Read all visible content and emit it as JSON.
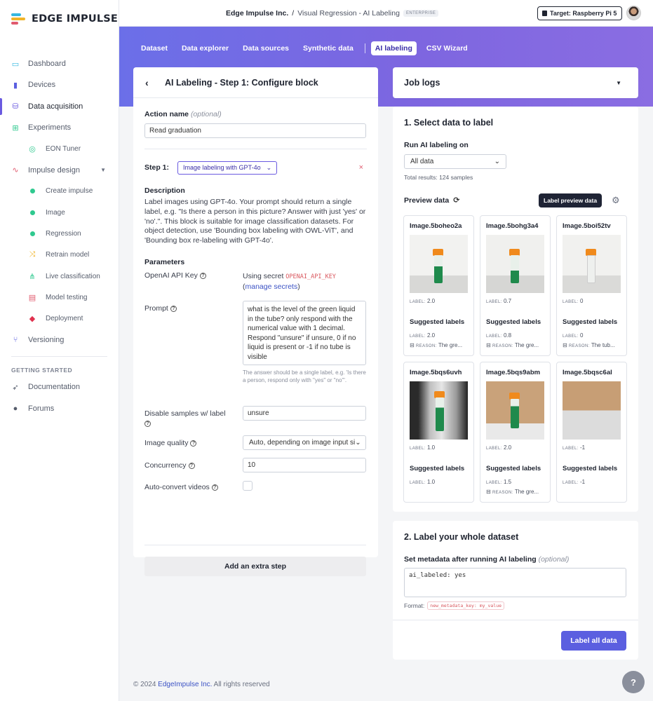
{
  "brand": {
    "name": "EDGE IMPULSE"
  },
  "sidebar": {
    "items": [
      {
        "label": "Dashboard",
        "icon": "monitor-icon",
        "color": "#36b7e0"
      },
      {
        "label": "Devices",
        "icon": "chip-icon",
        "color": "#5b5fe0"
      },
      {
        "label": "Data acquisition",
        "icon": "database-icon",
        "color": "#6a5ae0"
      },
      {
        "label": "Experiments",
        "icon": "table-icon",
        "color": "#2fc98f"
      },
      {
        "label": "EON Tuner",
        "icon": "compass-icon",
        "color": "#2fc98f"
      },
      {
        "label": "Impulse design",
        "icon": "pulse-icon",
        "color": "#e05a6e"
      },
      {
        "label": "Create impulse",
        "icon": "dot-icon"
      },
      {
        "label": "Image",
        "icon": "dot-icon"
      },
      {
        "label": "Regression",
        "icon": "dot-icon"
      },
      {
        "label": "Retrain model",
        "icon": "shuffle-icon",
        "color": "#f0b429"
      },
      {
        "label": "Live classification",
        "icon": "network-icon",
        "color": "#2fc98f"
      },
      {
        "label": "Model testing",
        "icon": "clipboard-icon",
        "color": "#e05a6e"
      },
      {
        "label": "Deployment",
        "icon": "cube-icon",
        "color": "#e0314e"
      },
      {
        "label": "Versioning",
        "icon": "branch-icon",
        "color": "#5b5fe0"
      }
    ],
    "getting_started": "GETTING STARTED",
    "bottom_items": [
      {
        "label": "Documentation",
        "icon": "rocket-icon"
      },
      {
        "label": "Forums",
        "icon": "chat-icon"
      }
    ]
  },
  "header": {
    "org": "Edge Impulse Inc.",
    "separator": "/",
    "project": "Visual Regression - AI Labeling",
    "badge": "ENTERPRISE",
    "target": "Target: Raspberry Pi 5"
  },
  "tabs": [
    "Dataset",
    "Data explorer",
    "Data sources",
    "Synthetic data",
    "AI labeling",
    "CSV Wizard"
  ],
  "configure": {
    "title": "AI Labeling - Step 1: Configure block",
    "action_name_label": "Action name",
    "action_name_optional": "(optional)",
    "action_name_value": "Read graduation",
    "step_label": "Step 1:",
    "step_block": "Image labeling with GPT-4o",
    "description_heading": "Description",
    "description": "Label images using GPT-4o. Your prompt should return a single label, e.g. \"Is there a person in this picture? Answer with just 'yes' or 'no'.\". This block is suitable for image classification datasets. For object detection, use 'Bounding box labeling with OWL-ViT', and 'Bounding box re-labeling with GPT-4o'.",
    "parameters_heading": "Parameters",
    "api_key_label": "OpenAI API Key",
    "api_key_prefix": "Using secret ",
    "api_key_secret": "OPENAI_API_KEY",
    "api_key_link": "manage secrets",
    "prompt_label": "Prompt",
    "prompt_value": "what is the level of the green liquid in the tube? only respond with the numerical value with 1 decimal. Respond \"unsure\" if unsure, 0 if no liquid is present or -1 if no tube is visible",
    "prompt_help": "The answer should be a single label, e.g. 'Is there a person, respond only with \"yes\" or \"no\"'.",
    "disable_label": "Disable samples w/ label",
    "disable_value": "unsure",
    "quality_label": "Image quality",
    "quality_value": "Auto, depending on image input si",
    "concurrency_label": "Concurrency",
    "concurrency_value": "10",
    "autoconvert_label": "Auto-convert videos",
    "add_step": "Add an extra step"
  },
  "job_logs": {
    "title": "Job logs"
  },
  "select_data": {
    "title": "1. Select data to label",
    "run_on_label": "Run AI labeling on",
    "run_on_value": "All data",
    "total": "Total results: 124 samples",
    "preview_label": "Preview data",
    "preview_button": "Label preview data",
    "label_key": "LABEL:",
    "reason_key": "REASON:",
    "suggested": "Suggested labels",
    "samples": [
      {
        "name": "Image.5boheo2a",
        "label": "2.0",
        "suggested": "2.0",
        "reason": "The gre..."
      },
      {
        "name": "Image.5bohg3a4",
        "label": "0.7",
        "suggested": "0.8",
        "reason": "The gre..."
      },
      {
        "name": "Image.5boi52tv",
        "label": "0",
        "suggested": "0",
        "reason": "The tub..."
      },
      {
        "name": "Image.5bqs6uvh",
        "label": "1.0",
        "suggested": "1.0",
        "reason": ""
      },
      {
        "name": "Image.5bqs9abm",
        "label": "2.0",
        "suggested": "1.5",
        "reason": "The gre..."
      },
      {
        "name": "Image.5bqsc6al",
        "label": "-1",
        "suggested": "-1",
        "reason": ""
      }
    ]
  },
  "whole_dataset": {
    "title": "2. Label your whole dataset",
    "metadata_label": "Set metadata after running AI labeling",
    "metadata_optional": "(optional)",
    "metadata_value": "ai_labeled: yes",
    "format_label": "Format:",
    "format_code": "new_metadata_key: my_value",
    "label_all": "Label all data"
  },
  "footer": {
    "prefix": "© 2024 ",
    "brand": "EdgeImpulse Inc.",
    "suffix": " All rights reserved"
  },
  "colors": {
    "accent": "#5b5fe0",
    "band_start": "#6b6fe8",
    "band_end": "#8a6de2",
    "danger": "#e05a6e"
  }
}
